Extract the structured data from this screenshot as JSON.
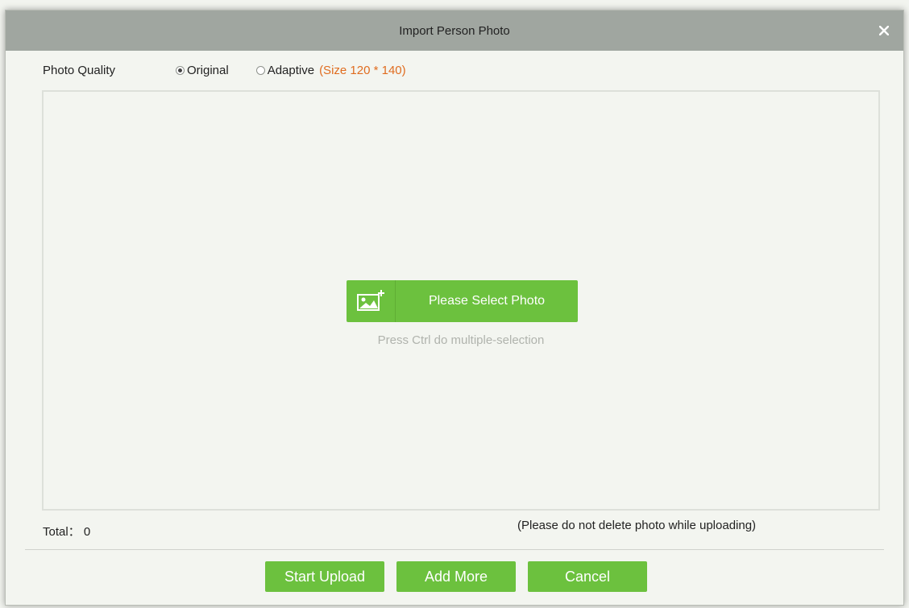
{
  "dialog": {
    "title": "Import Person Photo"
  },
  "photo_quality": {
    "label": "Photo Quality",
    "options": [
      {
        "label": "Original",
        "checked": true
      },
      {
        "label": "Adaptive",
        "checked": false
      }
    ],
    "size_note": "(Size 120 * 140)"
  },
  "upload_area": {
    "select_label": "Please Select Photo",
    "hint": "Press Ctrl do multiple-selection"
  },
  "status": {
    "total_label": "Total：",
    "total_value": "0",
    "warning": "(Please do not delete photo while uploading)"
  },
  "footer": {
    "start_upload": "Start Upload",
    "add_more": "Add More",
    "cancel": "Cancel"
  },
  "colors": {
    "accent_green": "#6cc13e",
    "size_note_orange": "#e06c1f",
    "titlebar_gray": "#a0a6a0"
  }
}
